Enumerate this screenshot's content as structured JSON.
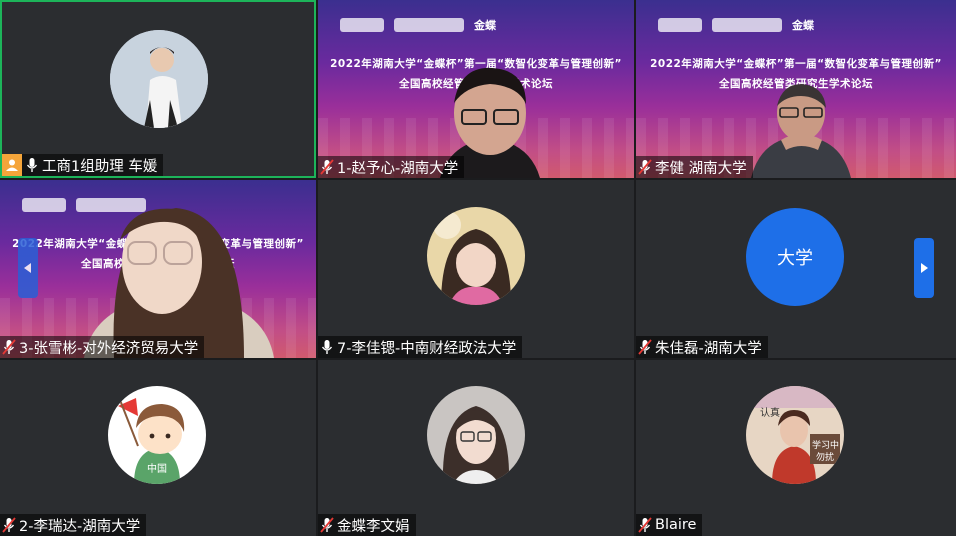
{
  "colors": {
    "background": "#1b1c1e",
    "tile": "#2b2d30",
    "active_border": "#1db45a",
    "host_badge": "#f5a53a",
    "avatar_blue": "#1e6fe8",
    "nav_arrow": "#1e6fe8"
  },
  "slide": {
    "line1": "2022年湖南大学“金蝶杯”第一届“数智化变革与管理创新”",
    "line2": "全国高校经管类研究生学术论坛",
    "logo_text": "金蝶"
  },
  "tiles": [
    {
      "name": "工商1组助理 车媛",
      "mic": "on",
      "host": true,
      "type": "avatar-photo"
    },
    {
      "name": "1-赵予心-湖南大学",
      "mic": "muted",
      "type": "video"
    },
    {
      "name": "李健 湖南大学",
      "mic": "muted",
      "type": "video"
    },
    {
      "name": "3-张雪彬-对外经济贸易大学",
      "mic": "muted",
      "type": "video"
    },
    {
      "name": "7-李佳锶-中南财经政法大学",
      "mic": "on",
      "type": "avatar-photo"
    },
    {
      "name": "朱佳磊-湖南大学",
      "mic": "muted",
      "type": "avatar-text",
      "avatar_text": "大学"
    },
    {
      "name": "2-李瑞达-湖南大学",
      "mic": "muted",
      "type": "avatar-cartoon",
      "badge_text": "中国"
    },
    {
      "name": "金蝶李文娟",
      "mic": "muted",
      "type": "avatar-photo"
    },
    {
      "name": "Blaire",
      "mic": "muted",
      "type": "avatar-photo",
      "sign_text_1": "认真",
      "sign_text_2": "学习中",
      "sign_text_3": "勿扰"
    }
  ],
  "nav": {
    "prev_icon": "chevron-left-icon",
    "next_icon": "chevron-right-icon"
  }
}
